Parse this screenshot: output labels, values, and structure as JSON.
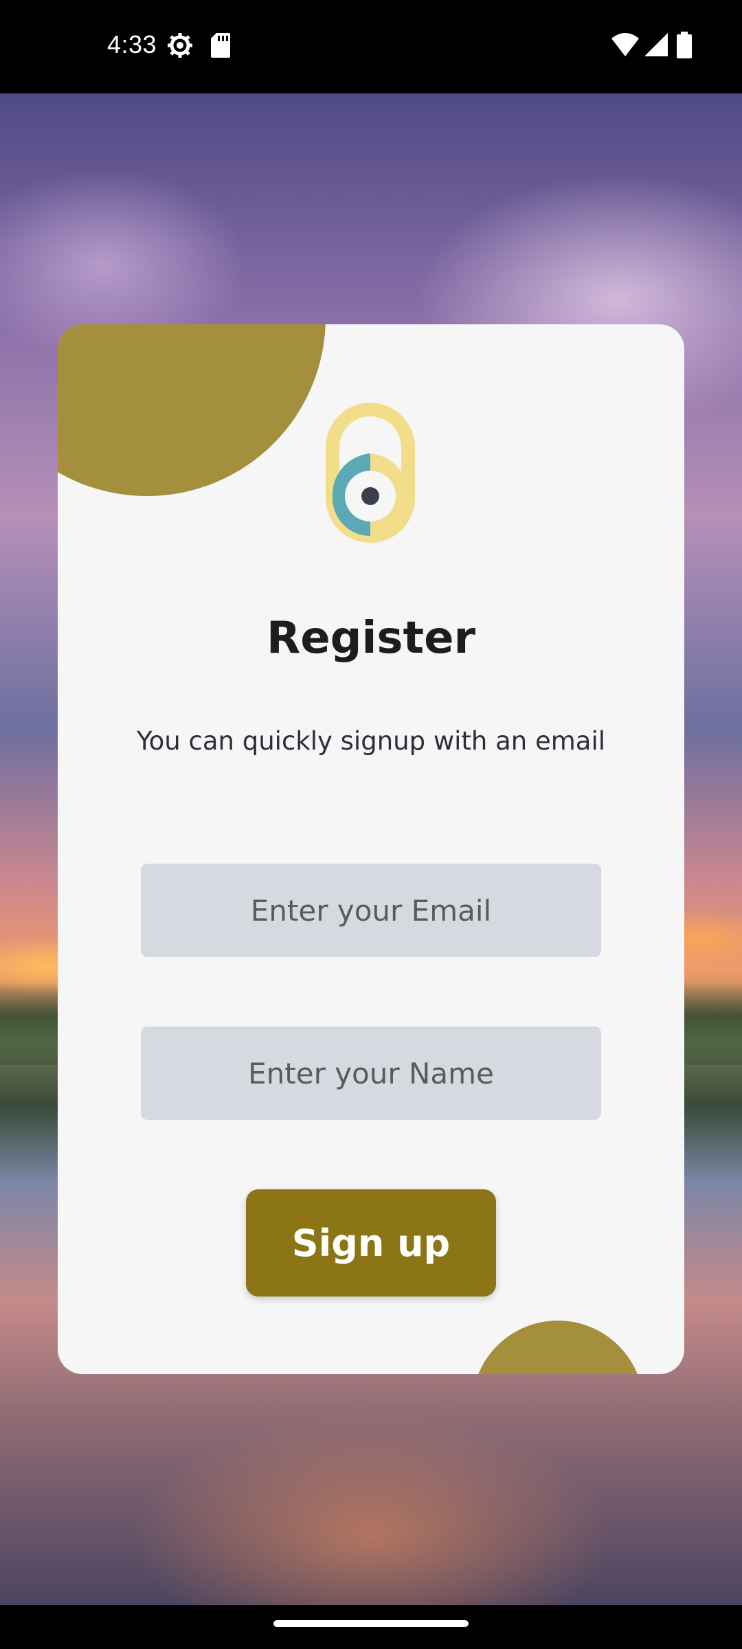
{
  "status_bar": {
    "time": "4:33",
    "icons": [
      "settings-gear-icon",
      "sd-card-icon",
      "wifi-icon",
      "cellular-signal-icon",
      "battery-icon"
    ]
  },
  "register": {
    "title": "Register",
    "subtitle": "You can quickly signup with an email",
    "email_placeholder": "Enter your Email",
    "name_placeholder": "Enter your Name",
    "signup_label": "Sign up"
  },
  "colors": {
    "accent": "#8b7514",
    "accent_blob": "#a38f3c",
    "field_bg": "#d7d9e0",
    "card_bg": "#f6f6f6",
    "logo_yellow": "#f1dd8a",
    "logo_teal": "#5aa9b4"
  }
}
